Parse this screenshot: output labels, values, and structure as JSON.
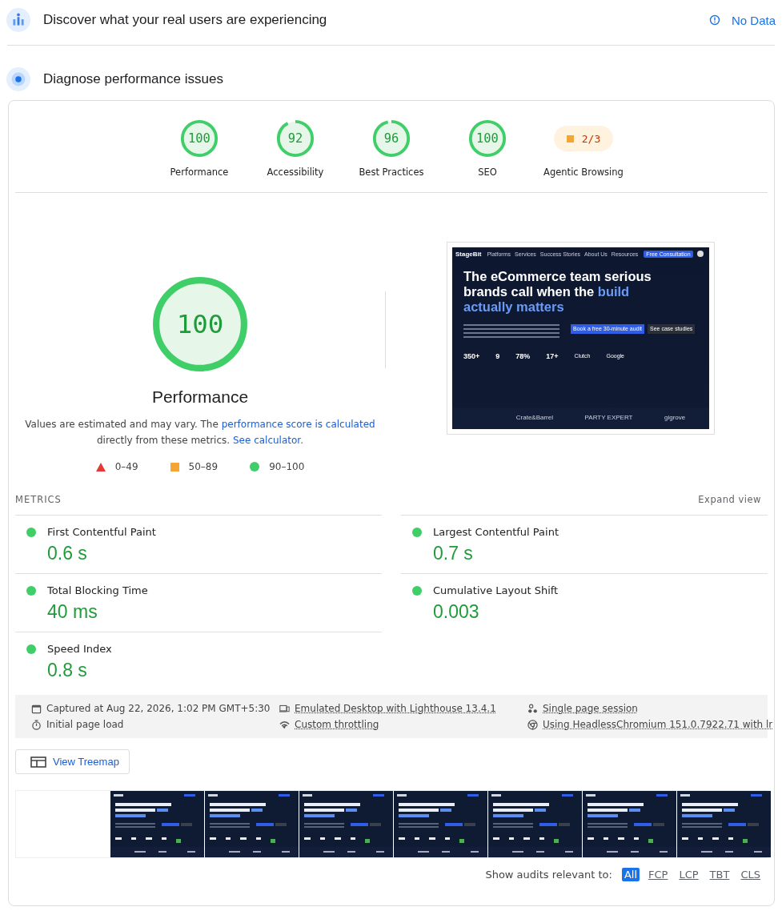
{
  "field_data": {
    "title": "Discover what your real users are experiencing",
    "status": "No Data"
  },
  "lab": {
    "title": "Diagnose performance issues"
  },
  "categories": [
    {
      "kind": "gauge",
      "label": "Performance",
      "score": "100",
      "level": 1
    },
    {
      "kind": "gauge",
      "label": "Accessibility",
      "score": "92",
      "level": 0.92
    },
    {
      "kind": "gauge",
      "label": "Best Practices",
      "score": "96",
      "level": 0.96
    },
    {
      "kind": "gauge",
      "label": "SEO",
      "score": "100",
      "level": 1
    },
    {
      "kind": "fraction",
      "label": "Agentic Browsing",
      "score": "2/3"
    }
  ],
  "main_score": {
    "score": "100",
    "level": 1,
    "label": "Performance",
    "note_start": "Values are estimated and may vary. The ",
    "note_link": "performance score is calculated",
    "note_middle": " directly from these metrics. ",
    "note_link_2": "See calculator."
  },
  "legend": [
    {
      "kind": "fail",
      "range": "0–49"
    },
    {
      "kind": "average",
      "range": "50–89"
    },
    {
      "kind": "pass",
      "range": "90–100"
    }
  ],
  "preview": {
    "logo": "StageBit",
    "nav": [
      "Platforms",
      "Services",
      "Success Stories",
      "About Us",
      "Resources"
    ],
    "cta": "Free Consultation",
    "headline": [
      {
        "text": "The eCommerce team serious brands call when the ",
        "highlight": false
      },
      {
        "text": "build actually matters",
        "highlight": true
      }
    ],
    "buttons": [
      "Book a free 30-minute audit",
      "See case studies"
    ],
    "stats": [
      "350+",
      "9",
      "78%",
      "17+"
    ],
    "badges": [
      "Clutch",
      "Google"
    ],
    "logos": [
      "Crate&Barrel",
      "PARTY EXPERT",
      "gigrove"
    ]
  },
  "metrics": {
    "title": "METRICS",
    "toggle": "Expand view",
    "items": [
      {
        "name": "First Contentful Paint",
        "value": "0.6 s"
      },
      {
        "name": "Largest Contentful Paint",
        "value": "0.7 s"
      },
      {
        "name": "Total Blocking Time",
        "value": "40 ms"
      },
      {
        "name": "Cumulative Layout Shift",
        "value": "0.003"
      },
      {
        "name": "Speed Index",
        "value": "0.8 s"
      }
    ]
  },
  "run_info": [
    {
      "kind": "calendar",
      "text": "Captured at Aug 22, 2026, 1:02 PM GMT+5:30",
      "link": false
    },
    {
      "kind": "device",
      "text": "Emulated Desktop with Lighthouse 13.4.1",
      "link": true
    },
    {
      "kind": "session",
      "text": "Single page session",
      "link": true
    },
    {
      "kind": "timer",
      "text": "Initial page load",
      "link": false
    },
    {
      "kind": "network",
      "text": "Custom throttling",
      "link": true
    },
    {
      "kind": "browser",
      "text": "Using HeadlessChromium 151.0.7922.71 with lr",
      "link": true
    }
  ],
  "treemap_button": "View Treemap",
  "filmstrip": {
    "frames": [
      {
        "kind": "blank"
      },
      {
        "kind": "page"
      },
      {
        "kind": "page"
      },
      {
        "kind": "page"
      },
      {
        "kind": "page"
      },
      {
        "kind": "page"
      },
      {
        "kind": "page"
      },
      {
        "kind": "page"
      }
    ]
  },
  "audit_filter": {
    "label": "Show audits relevant to:",
    "options": [
      {
        "label": "All",
        "selected": true
      },
      {
        "label": "FCP",
        "selected": false
      },
      {
        "label": "LCP",
        "selected": false
      },
      {
        "label": "TBT",
        "selected": false
      },
      {
        "label": "CLS",
        "selected": false
      }
    ]
  }
}
